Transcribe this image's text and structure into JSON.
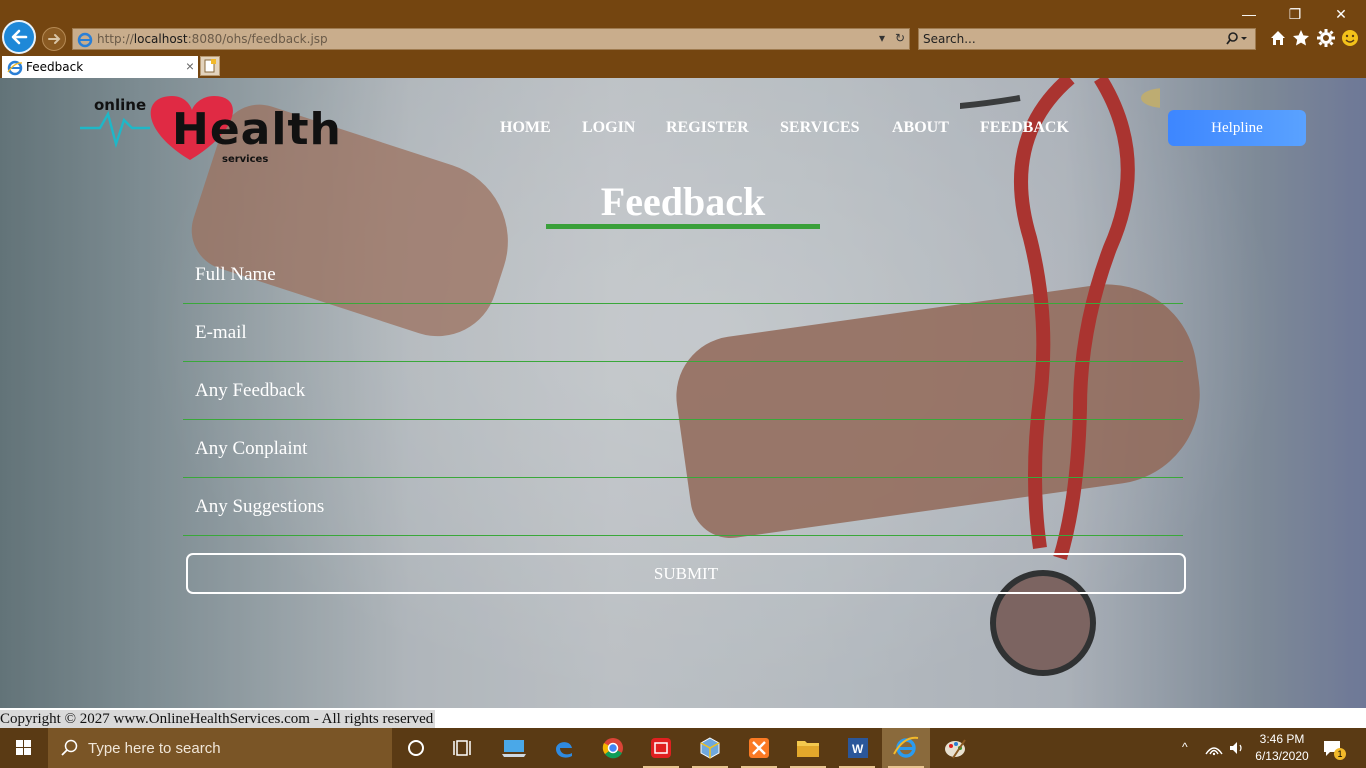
{
  "browser": {
    "address_host_prefix": "http://",
    "address_host": "localhost",
    "address_path": ":8080/ohs/feedback.jsp",
    "search_placeholder": "Search...",
    "tab_title": "Feedback",
    "tab_close": "×",
    "window_controls": [
      "—",
      "❐",
      "✕"
    ]
  },
  "site": {
    "logo_online": "online",
    "logo_health": "Health",
    "logo_services": "services",
    "nav": [
      "HOME",
      "LOGIN",
      "REGISTER",
      "SERVICES",
      "ABOUT",
      "FEEDBACK"
    ],
    "helpline": "Helpline"
  },
  "form": {
    "title": "Feedback",
    "fields": [
      {
        "placeholder": "Full Name",
        "value": ""
      },
      {
        "placeholder": "E-mail",
        "value": ""
      },
      {
        "placeholder": "Any Feedback",
        "value": ""
      },
      {
        "placeholder": "Any Conplaint",
        "value": ""
      },
      {
        "placeholder": "Any Suggestions",
        "value": ""
      }
    ],
    "submit": "SUBMIT"
  },
  "footer": {
    "copyright": "Copyright © 2027 www.OnlineHealthServices.com - All rights reserved"
  },
  "taskbar": {
    "search_placeholder": "Type here to search",
    "time": "3:46 PM",
    "date": "6/13/2020",
    "notification_count": "1"
  },
  "colors": {
    "accent_green": "#3aa03a",
    "helpline_blue": "#3d86ff",
    "chrome_brown": "#744510"
  }
}
